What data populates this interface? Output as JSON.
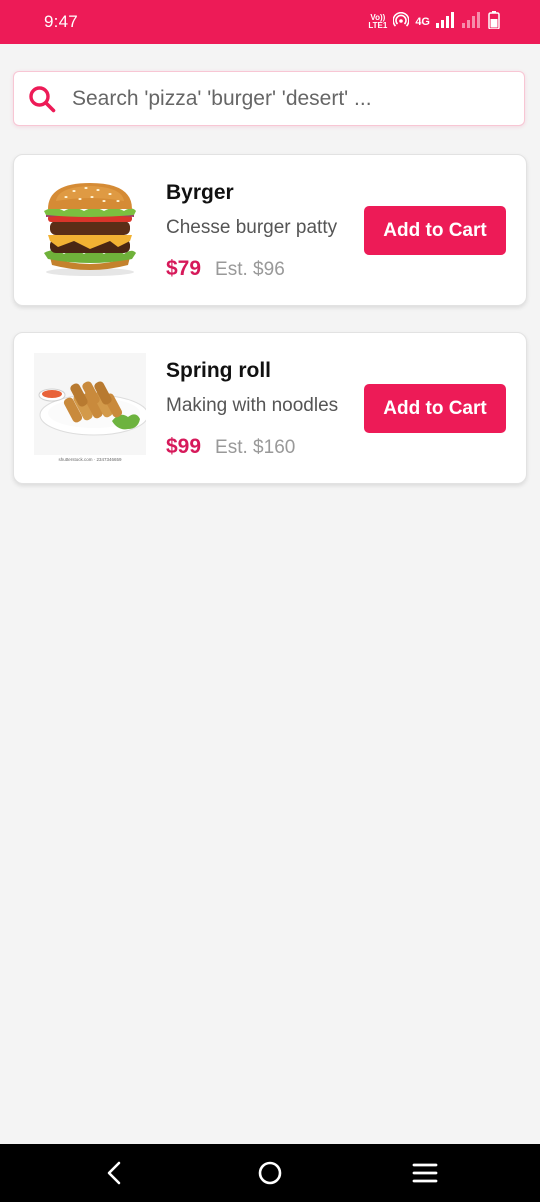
{
  "status_bar": {
    "time": "9:47",
    "volte_top": "Vo))",
    "volte_bottom": "LTE1",
    "network": "4G",
    "background": "#ed1b57"
  },
  "search": {
    "placeholder": "Search 'pizza' 'burger' 'desert' ...",
    "value": "",
    "icon": "search-icon"
  },
  "products": [
    {
      "name": "Byrger",
      "description": "Chesse burger patty",
      "price": "$79",
      "estimate": "Est. $96",
      "button_label": "Add to Cart",
      "image": "burger-image"
    },
    {
      "name": "Spring roll",
      "description": "Making with noodles",
      "price": "$99",
      "estimate": "Est. $160",
      "button_label": "Add to Cart",
      "image": "spring-roll-image",
      "image_caption": "shutterstock.com · 2347346659"
    }
  ],
  "nav_bar": {
    "buttons": [
      "back-icon",
      "home-icon",
      "menu-icon"
    ]
  },
  "colors": {
    "accent": "#ed1b57",
    "price": "#d6195a",
    "background": "#f4f4f4"
  }
}
